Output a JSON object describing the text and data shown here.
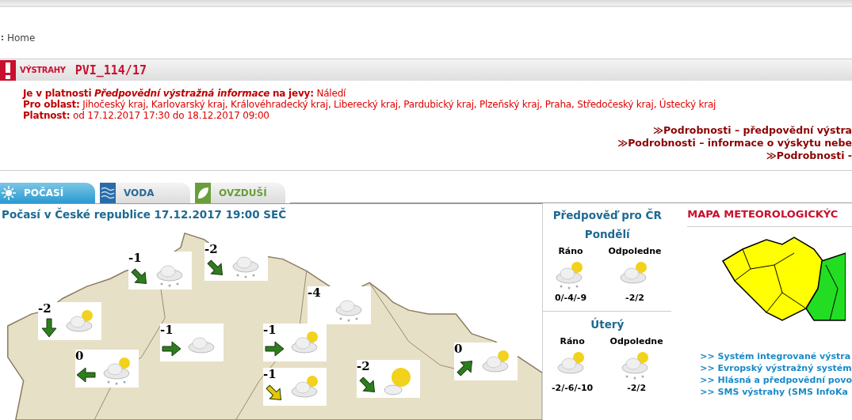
{
  "breadcrumb": {
    "label": "Home"
  },
  "warning": {
    "logo": "VÝSTRAHY",
    "code": "PVI_114/17",
    "lines": [
      "**Je v platnosti** *Předpovědní výstražná informace* **na jevy:** Náledí",
      "**Pro oblast:** Jihočeský kraj, Karlovarský kraj, Královéhradecký kraj, Liberecký kraj, Pardubický kraj, Plzeňský kraj, Praha, Středočeský kraj, Ústecký kraj",
      "**Platnost:** od 17.12.2017 17:30 do 18.12.2017 09:00"
    ],
    "links": [
      "≫Podrobnosti – předpovědní výstra",
      "≫Podrobnosti – informace o výskytu nebe",
      "≫Podrobnosti -"
    ]
  },
  "tabs": [
    {
      "label": "POČASÍ",
      "kind": "sun",
      "selected": true
    },
    {
      "label": "VODA",
      "kind": "water",
      "selected": false
    },
    {
      "label": "OVZDUŠÍ",
      "kind": "leaf",
      "selected": false
    }
  ],
  "weather_map": {
    "title": "Počasí v České republice 17.12.2017 19:00 SEČ",
    "stations": [
      {
        "temp": "-1",
        "arrow": {
          "kind": "se",
          "color": "#2e7d1e"
        },
        "kind": "snow"
      },
      {
        "temp": "-2",
        "arrow": {
          "kind": "se",
          "color": "#2e7d1e"
        },
        "kind": "snow"
      },
      {
        "temp": "-4",
        "kind": "snow"
      },
      {
        "temp": "-2",
        "arrow": {
          "kind": "s",
          "color": "#2e7d1e"
        },
        "kind": "partly"
      },
      {
        "temp": "-1",
        "arrow": {
          "kind": "e",
          "color": "#2e7d1e"
        },
        "kind": "cloud"
      },
      {
        "temp": "-1",
        "arrow": {
          "kind": "e",
          "color": "#2e7d1e"
        },
        "kind": "partly"
      },
      {
        "temp": "0",
        "arrow": {
          "kind": "w",
          "color": "#2e7d1e"
        },
        "kind": "partly_snow"
      },
      {
        "temp": "-1",
        "arrow": {
          "kind": "se",
          "color": "#e8c800"
        },
        "kind": "partly"
      },
      {
        "temp": "-2",
        "arrow": {
          "kind": "se",
          "color": "#2e7d1e"
        },
        "kind": "sunny"
      },
      {
        "temp": "0",
        "arrow": {
          "kind": "ne",
          "color": "#2e7d1e"
        },
        "kind": "partly"
      }
    ]
  },
  "forecast": {
    "title": "Předpověď pro ČR",
    "days": [
      {
        "name": "Pondělí",
        "parts": [
          {
            "label": "Ráno",
            "kind": "partly_snow",
            "temps": "0/-4/-9"
          },
          {
            "label": "Odpoledne",
            "kind": "partly",
            "temps": "-2/2"
          }
        ]
      },
      {
        "name": "Úterý",
        "parts": [
          {
            "label": "Ráno",
            "kind": "partly",
            "temps": "-2/-6/-10"
          },
          {
            "label": "Odpoledne",
            "kind": "partly_snow",
            "temps": "-2/2"
          }
        ]
      }
    ]
  },
  "side": {
    "title": "MAPA METEOROLOGICKÝC",
    "links": [
      ">> Systém integrované výstra",
      ">> Evropský výstražný systém",
      ">> Hlásná a předpovědní povo",
      ">> SMS výstrahy (SMS InfoKa"
    ]
  }
}
